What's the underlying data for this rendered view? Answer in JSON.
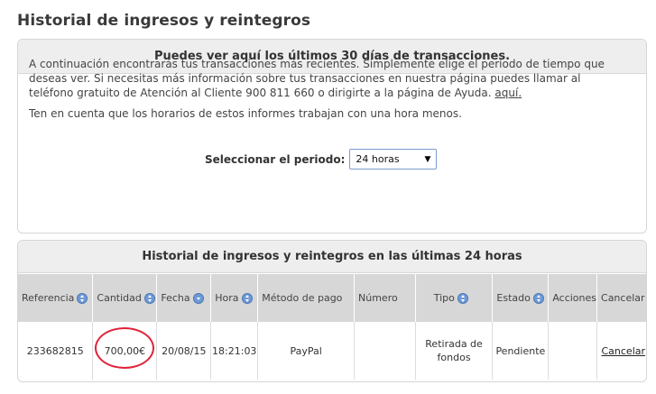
{
  "page_title": "Historial de ingresos y reintegros",
  "info_panel": {
    "header": "Puedes ver aquí los últimos 30 días de transacciones.",
    "intro_text": "A continuación encontrarás tus transacciones más recientes. Simplemente elige el período de tiempo que deseas ver. Si necesitas más información sobre tus transacciones en nuestra página puedes llamar al teléfono gratuito de Atención al Cliente 900 811 660 o dirigirte a la página de Ayuda.",
    "help_link": "aquí.",
    "note": "Ten en cuenta que los horarios de estos informes trabajan con una hora menos.",
    "period_label": "Seleccionar el periodo:",
    "period_value": "24 horas"
  },
  "history_panel": {
    "header": "Historial de ingresos y reintegros en las últimas 24 horas",
    "columns": [
      "Referencia",
      "Cantidad",
      "Fecha",
      "Hora",
      "Método de pago",
      "Número",
      "Tipo",
      "Estado",
      "Acciones",
      "Cancelar"
    ],
    "rows": [
      {
        "referencia": "233682815",
        "cantidad": "700,00€",
        "fecha": "20/08/15",
        "hora": "18:21:03",
        "metodo": "PayPal",
        "numero": "",
        "tipo": "Retirada de fondos",
        "estado": "Pendiente",
        "acciones": "",
        "cancelar": "Cancelar"
      }
    ]
  },
  "colors": {
    "highlight_circle": "#e0223a",
    "sort_icon": "#6f9ad8"
  }
}
